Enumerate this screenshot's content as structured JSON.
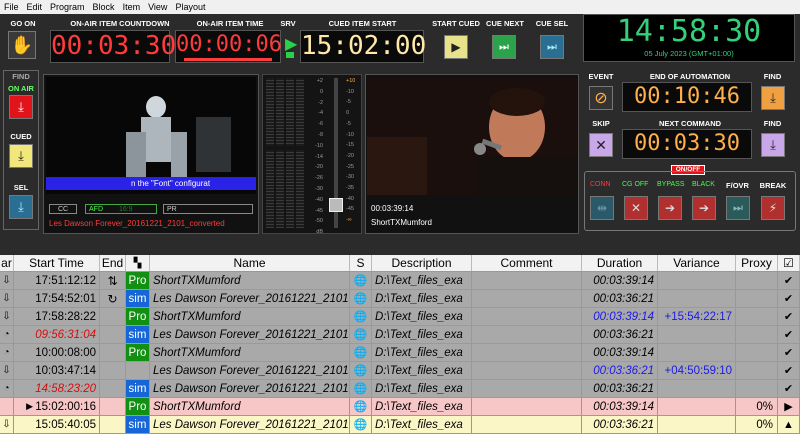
{
  "menu": [
    "File",
    "Edit",
    "Program",
    "Block",
    "Item",
    "View",
    "Playout"
  ],
  "top": {
    "go_on": "GO ON",
    "countdown_label": "ON-AIR ITEM COUNTDOWN",
    "countdown": "00:03:30",
    "item_time_label": "ON-AIR ITEM TIME",
    "item_time": "00:00:06",
    "srv_label": "SRV",
    "cued_start_label": "CUED ITEM START",
    "cued_start": "15:02:00",
    "start_cued": "START CUED",
    "cue_next": "CUE NEXT",
    "cue_sel": "CUE SEL",
    "clock": "14:58:30",
    "date": "05 July 2023 (GMT+01:00)"
  },
  "left": {
    "find": "FIND",
    "on_air": "ON AIR",
    "cued": "CUED",
    "sel": "SEL"
  },
  "preview": {
    "ticker": "n the \"Font\" configurat",
    "cc": "CC",
    "afd": "AFD",
    "afd_val": "16:9",
    "pr": "PR",
    "filename": "Les Dawson Forever_20161221_2101_converted"
  },
  "meter": {
    "scale": [
      "+2",
      "0",
      "-2",
      "-4",
      "-6",
      "-8",
      "-10",
      "-14",
      "-20",
      "-26",
      "-30",
      "-40",
      "-45",
      "-50",
      "dB"
    ],
    "scale2": [
      "-10",
      "-5",
      "0",
      "-5",
      "-10",
      "-15",
      "-20",
      "-25",
      "-30",
      "-35",
      "-40",
      "-45",
      "-50",
      "-∞"
    ],
    "top_mark": "+10",
    "bottom_mark": "-∞"
  },
  "live": {
    "time": "00:03:39:14",
    "name": "ShortTXMumford"
  },
  "right": {
    "event": "EVENT",
    "end_label": "END OF AUTOMATION",
    "end_time": "00:10:46",
    "find": "FIND",
    "skip": "SKIP",
    "next_label": "NEXT COMMAND",
    "next_time": "00:03:30",
    "find2": "FIND",
    "onoff": "ON/OFF",
    "conn": "CONN",
    "cgoff": "CG OFF",
    "bypass": "BYPASS",
    "black": "BLACK",
    "fovr": "F/OVR",
    "brk": "BREAK"
  },
  "table": {
    "headers": [
      "ar",
      "Start Time",
      "End",
      "",
      "Name",
      "S",
      "Description",
      "Comment",
      "Duration",
      "Variance",
      "Proxy",
      "☑"
    ],
    "rows": [
      {
        "icon": "⇩",
        "start": "17:51:12:12",
        "end": "⇅",
        "type": "Pro",
        "name": "ShortTXMumford",
        "desc": "D:\\Text_files_exa",
        "comment": "",
        "dur": "00:03:39:14",
        "var": "",
        "proxy": "",
        "chk": "✔",
        "bg": "gray",
        "start_red": false,
        "dur_blue": false
      },
      {
        "icon": "⇩",
        "start": "17:54:52:01",
        "end": "↻",
        "type": "sim",
        "name": "Les Dawson Forever_20161221_2101",
        "desc": "D:\\Text_files_exa",
        "comment": "",
        "dur": "00:03:36:21",
        "var": "",
        "proxy": "",
        "chk": "✔",
        "bg": "gray",
        "start_red": false,
        "dur_blue": false
      },
      {
        "icon": "⇩",
        "start": "17:58:28:22",
        "end": "",
        "type": "Pro",
        "name": "ShortTXMumford",
        "desc": "D:\\Text_files_exa",
        "comment": "",
        "dur": "00:03:39:14",
        "var": "+15:54:22:17",
        "proxy": "",
        "chk": "✔",
        "bg": "gray",
        "start_red": false,
        "dur_blue": true
      },
      {
        "icon": "◔",
        "start": "09:56:31:04",
        "end": "",
        "type": "sim",
        "name": "Les Dawson Forever_20161221_2101",
        "desc": "D:\\Text_files_exa",
        "comment": "",
        "dur": "00:03:36:21",
        "var": "",
        "proxy": "",
        "chk": "✔",
        "bg": "gray",
        "start_red": true,
        "dur_blue": false
      },
      {
        "icon": "◔",
        "start": "10:00:08:00",
        "end": "",
        "type": "Pro",
        "name": "ShortTXMumford",
        "desc": "D:\\Text_files_exa",
        "comment": "",
        "dur": "00:03:39:14",
        "var": "",
        "proxy": "",
        "chk": "✔",
        "bg": "gray",
        "start_red": false,
        "dur_blue": false
      },
      {
        "icon": "⇩",
        "start": "10:03:47:14",
        "end": "",
        "type": "",
        "name": "Les Dawson Forever_20161221_2101",
        "desc": "D:\\Text_files_exa",
        "comment": "",
        "dur": "00:03:36:21",
        "var": "+04:50:59:10",
        "proxy": "",
        "chk": "✔",
        "bg": "gray",
        "start_red": false,
        "dur_blue": true
      },
      {
        "icon": "◔",
        "start": "14:58:23:20",
        "end": "",
        "type": "sim",
        "name": "Les Dawson Forever_20161221_2101",
        "desc": "D:\\Text_files_exa",
        "comment": "",
        "dur": "00:03:36:21",
        "var": "",
        "proxy": "",
        "chk": "✔",
        "bg": "gray",
        "start_red": true,
        "dur_blue": false
      },
      {
        "icon": "",
        "start": "►15:02:00:16",
        "end": "",
        "type": "Pro",
        "name": "ShortTXMumford",
        "desc": "D:\\Text_files_exa",
        "comment": "",
        "dur": "00:03:39:14",
        "var": "",
        "proxy": "0%",
        "chk": "▶",
        "bg": "pink",
        "start_red": false,
        "dur_blue": false
      },
      {
        "icon": "⇩",
        "start": "15:05:40:05",
        "end": "",
        "type": "sim",
        "name": "Les Dawson Forever_20161221_2101",
        "desc": "D:\\Text_files_exa",
        "comment": "",
        "dur": "00:03:36:21",
        "var": "",
        "proxy": "0%",
        "chk": "▲",
        "bg": "yellowrow",
        "start_red": false,
        "dur_blue": false
      }
    ]
  },
  "colors": {
    "accent_red": "#ff3b3b",
    "clock_green": "#35d07a",
    "onair_red": "#e0141a",
    "cued_yellow": "#f2e77a",
    "orange_digits": "#ffb04a"
  }
}
